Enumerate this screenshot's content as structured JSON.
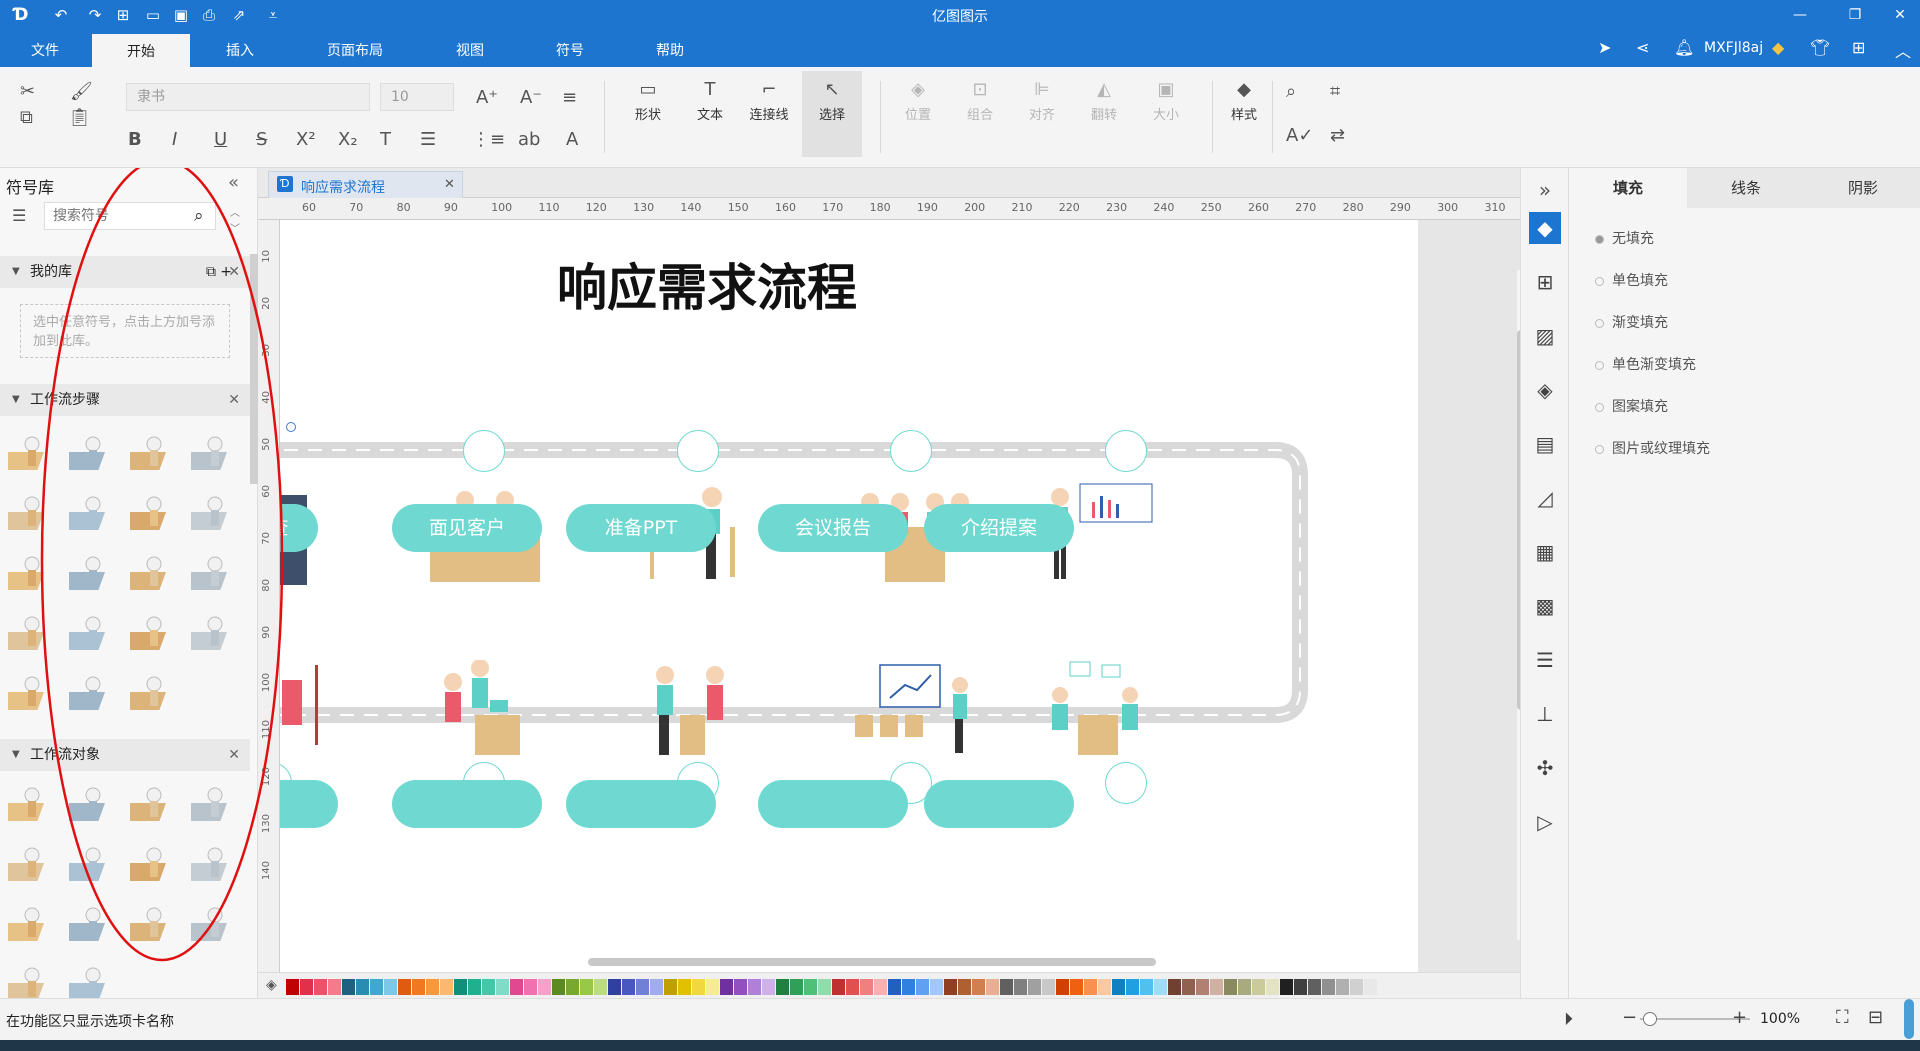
{
  "app": {
    "title": "亿图图示",
    "user": "MXFJl8aj"
  },
  "menu": {
    "tabs": [
      "文件",
      "开始",
      "插入",
      "页面布局",
      "视图",
      "符号",
      "帮助"
    ],
    "active": "开始"
  },
  "ribbon": {
    "font_name": "隶书",
    "font_size": "10",
    "tools": [
      {
        "label": "形状",
        "icon": "shape-icon"
      },
      {
        "label": "文本",
        "icon": "text-icon"
      },
      {
        "label": "连接线",
        "icon": "connector-icon"
      },
      {
        "label": "选择",
        "icon": "select-icon"
      }
    ],
    "arrange": [
      "位置",
      "组合",
      "对齐",
      "翻转",
      "大小"
    ],
    "style_label": "样式"
  },
  "library": {
    "title": "符号库",
    "search_placeholder": "搜索符号",
    "my_library": "我的库",
    "my_library_hint": "选中任意符号，点击上方加号添加到此库。",
    "sections": [
      "工作流步骤",
      "工作流对象"
    ]
  },
  "document": {
    "tab": "响应需求流程"
  },
  "ruler": {
    "h": [
      "60",
      "70",
      "80",
      "90",
      "100",
      "110",
      "120",
      "130",
      "140",
      "150",
      "160",
      "170",
      "180",
      "190",
      "200",
      "210",
      "220",
      "230",
      "240",
      "250",
      "260",
      "270",
      "280",
      "290",
      "300",
      "310"
    ],
    "v": [
      "10",
      "20",
      "30",
      "40",
      "50",
      "60",
      "70",
      "80",
      "90",
      "100",
      "110",
      "120",
      "130",
      "140"
    ]
  },
  "diagram": {
    "title": "响应需求流程",
    "row1": [
      "面见客户",
      "准备PPT",
      "会议报告",
      "介绍提案"
    ],
    "partial_label": "查"
  },
  "props": {
    "tabs": [
      "填充",
      "线条",
      "阴影"
    ],
    "fill_options": [
      "无填充",
      "单色填充",
      "渐变填充",
      "单色渐变填充",
      "图案填充",
      "图片或纹理填充"
    ]
  },
  "status": {
    "text": "在功能区只显示选项卡名称",
    "zoom": "100%"
  },
  "colors": {
    "accent": "#1e75d0",
    "teal": "#6fd9d1",
    "annotation": "#e01010"
  }
}
